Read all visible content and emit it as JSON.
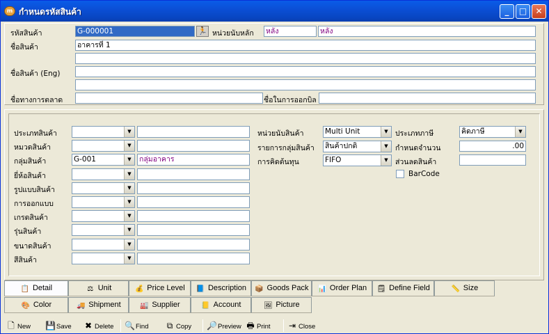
{
  "window": {
    "title": "กำหนดรหัสสินค้า",
    "app_icon_text": "m"
  },
  "header": {
    "code_label": "รหัสสินค้า",
    "code_value": "G-000001",
    "main_unit_label": "หน่วยนับหลัก",
    "main_unit_code": "หลัง",
    "main_unit_name": "หลัง",
    "name_label": "ชื่อสินค้า",
    "name_value": "อาคารที่ 1",
    "name_line2": "",
    "name_eng_label": "ชื่อสินค้า (Eng)",
    "name_eng_value": "",
    "name_eng_line2": "",
    "market_name_label": "ชื่อทางการตลาด",
    "market_name_value": "",
    "bill_name_label": "ชื่อในการออกบิล",
    "bill_name_value": ""
  },
  "detail_left": [
    {
      "label": "ประเภทสินค้า",
      "code": "",
      "name": ""
    },
    {
      "label": "หมวดสินค้า",
      "code": "",
      "name": ""
    },
    {
      "label": "กลุ่มสินค้า",
      "code": "G-001",
      "name": "กลุ่มอาคาร"
    },
    {
      "label": "ยี่ห้อสินค้า",
      "code": "",
      "name": ""
    },
    {
      "label": "รูปแบบสินค้า",
      "code": "",
      "name": ""
    },
    {
      "label": "การออกแบบ",
      "code": "",
      "name": ""
    },
    {
      "label": "เกรดสินค้า",
      "code": "",
      "name": ""
    },
    {
      "label": "รุ่นสินค้า",
      "code": "",
      "name": ""
    },
    {
      "label": "ขนาดสินค้า",
      "code": "",
      "name": ""
    },
    {
      "label": "สีสินค้า",
      "code": "",
      "name": ""
    }
  ],
  "detail_mid": [
    {
      "label": "หน่วยนับสินค้า",
      "value": "Multi Unit"
    },
    {
      "label": "รายการกลุ่มสินค้า",
      "value": "สินค้าปกติ"
    },
    {
      "label": "การคิดต้นทุน",
      "value": "FIFO"
    }
  ],
  "detail_right": {
    "tax_type_label": "ประเภทภาษี",
    "tax_type_value": "คิดภาษี",
    "quantity_label": "กำหนดจำนวน",
    "quantity_value": ".00",
    "discount_label": "ส่วนลดสินค้า",
    "discount_value": "",
    "barcode_label": "BarCode"
  },
  "tabs_row1": [
    {
      "label": "Detail",
      "icon": "📋"
    },
    {
      "label": "Unit",
      "icon": "⚖"
    },
    {
      "label": "Price Level",
      "icon": "💰"
    },
    {
      "label": "Description",
      "icon": "📘"
    },
    {
      "label": "Goods Pack",
      "icon": "📦"
    },
    {
      "label": "Order Plan",
      "icon": "📊"
    },
    {
      "label": "Define Field",
      "icon": "🗒"
    },
    {
      "label": "Size",
      "icon": "📏"
    }
  ],
  "tabs_row2": [
    {
      "label": "Color",
      "icon": "🎨"
    },
    {
      "label": "Shipment",
      "icon": "🚚"
    },
    {
      "label": "Supplier",
      "icon": "🏭"
    },
    {
      "label": "Account",
      "icon": "📒"
    },
    {
      "label": "Picture",
      "icon": "🖼"
    }
  ],
  "toolbar": [
    {
      "label": "New",
      "icon": "🗋"
    },
    {
      "label": "Save",
      "icon": "💾"
    },
    {
      "label": "Delete",
      "icon": "✖"
    },
    {
      "label": "Find",
      "icon": "🔍"
    },
    {
      "label": "Copy",
      "icon": "⧉"
    },
    {
      "label": "Preview",
      "icon": "🔎"
    },
    {
      "label": "Print",
      "icon": "🖶"
    },
    {
      "label": "Close",
      "icon": "⇥"
    }
  ],
  "colors": {
    "title_bar": "#0b4fd6",
    "selection": "#316ac5",
    "readonly_text": "#800080"
  }
}
